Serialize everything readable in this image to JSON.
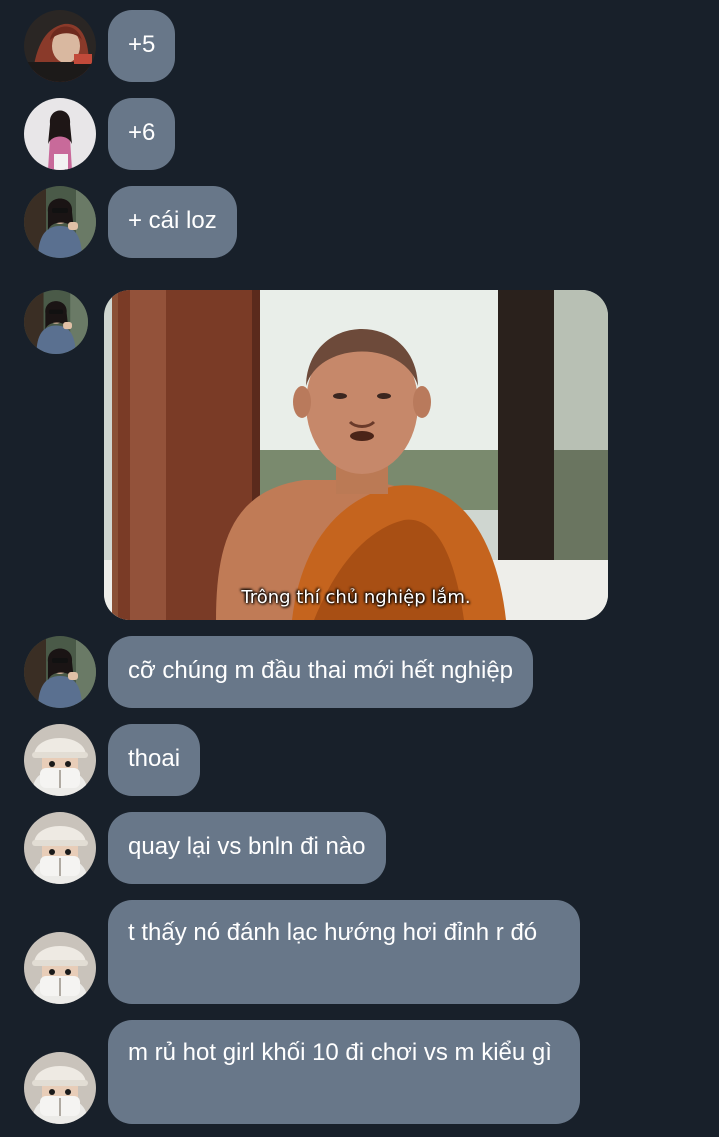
{
  "messages": [
    {
      "text": "+5",
      "avatar": "woman-red-hair-avatar"
    },
    {
      "text": "+6",
      "avatar": "woman-pink-top-avatar"
    },
    {
      "text": "+ cái loz",
      "avatar": "woman-sunglasses-avatar"
    },
    {
      "type": "image",
      "avatar": "woman-sunglasses-avatar",
      "caption": "Trông thí chủ nghiệp lắm.",
      "image_description": "monk-meme-image"
    },
    {
      "text": "cỡ chúng m đầu thai mới hết nghiệp",
      "avatar": "woman-sunglasses-avatar"
    },
    {
      "text": "thoai",
      "avatar": "masked-girl-avatar"
    },
    {
      "text": "quay lại vs bnln đi nào",
      "avatar": "masked-girl-avatar"
    },
    {
      "text": "t thấy nó đánh lạc hướng hơi đỉnh r đó",
      "avatar": "masked-girl-avatar"
    },
    {
      "text": "m rủ hot girl khối 10 đi chơi vs m kiểu gì",
      "avatar": "masked-girl-avatar"
    }
  ],
  "colors": {
    "background": "#18202a",
    "bubble": "#687789",
    "text": "#ffffff"
  }
}
